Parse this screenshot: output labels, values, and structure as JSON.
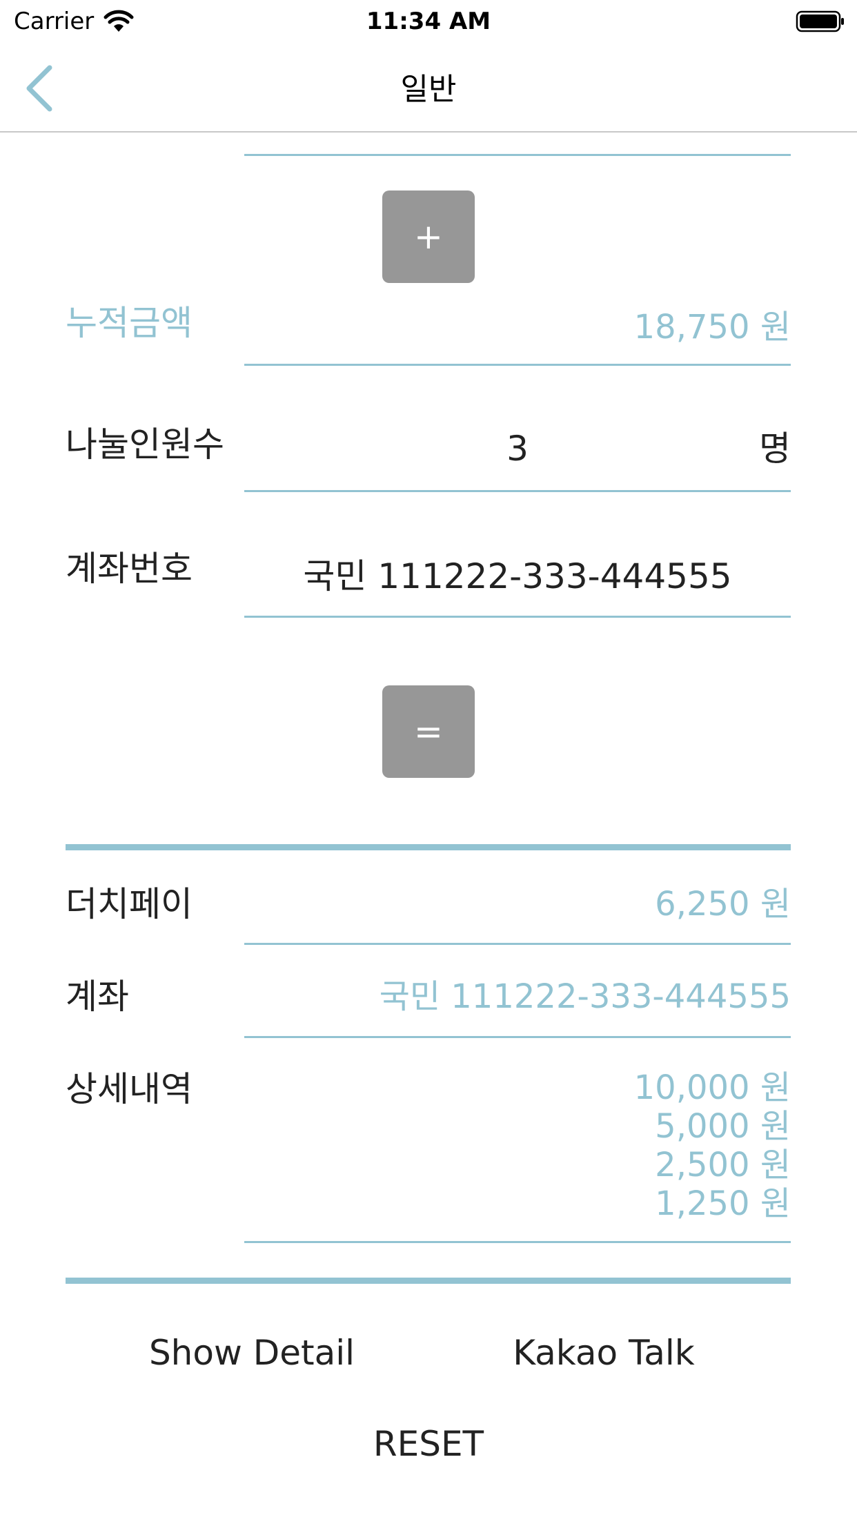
{
  "status_bar": {
    "carrier": "Carrier",
    "time": "11:34 AM",
    "icons": [
      "wifi-icon",
      "battery-icon"
    ]
  },
  "nav": {
    "title": "일반",
    "back_icon": "chevron-left-icon",
    "accent_color": "#92c3d2"
  },
  "buttons": {
    "add": "+",
    "equals": "=",
    "button_color": "#979797"
  },
  "accumulated": {
    "label": "누적금액",
    "value": "18,750 원"
  },
  "split_count": {
    "label": "나눌인원수",
    "value": "3",
    "unit": "명"
  },
  "account_input": {
    "label": "계좌번호",
    "value": "국민 111222-333-444555"
  },
  "result": {
    "dutch_label": "더치페이",
    "dutch_value": "6,250 원",
    "account_label": "계좌",
    "account_value": "국민 111222-333-444555",
    "detail_label": "상세내역",
    "details": [
      "10,000 원",
      "5,000 원",
      "2,500 원",
      "1,250 원"
    ]
  },
  "actions": {
    "show_detail": "Show Detail",
    "kakao_talk": "Kakao Talk",
    "reset": "RESET"
  }
}
